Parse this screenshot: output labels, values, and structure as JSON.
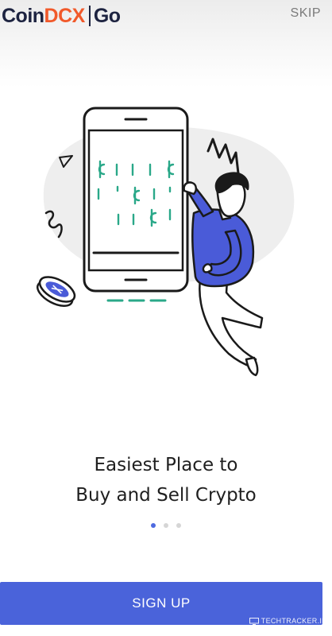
{
  "header": {
    "logo": {
      "part1": "Coin",
      "part2": "DCX",
      "part3": "Go"
    },
    "skip_label": "SKIP"
  },
  "main": {
    "headline_line1": "Easiest Place to",
    "headline_line2": "Buy and Sell Crypto",
    "pager": {
      "total": 3,
      "active": 1
    },
    "signup_label": "SIGN UP"
  },
  "watermark": {
    "text": "TECHTRACKER.IN"
  },
  "colors": {
    "brand_primary": "#4a63da",
    "logo_dark": "#1d2340",
    "logo_accent": "#f1592a",
    "coin_green": "#2aa889",
    "character_blue": "#4a5bd8"
  },
  "icons": [
    "crypto-coin-icon",
    "phone-illustration",
    "person-illustration"
  ]
}
